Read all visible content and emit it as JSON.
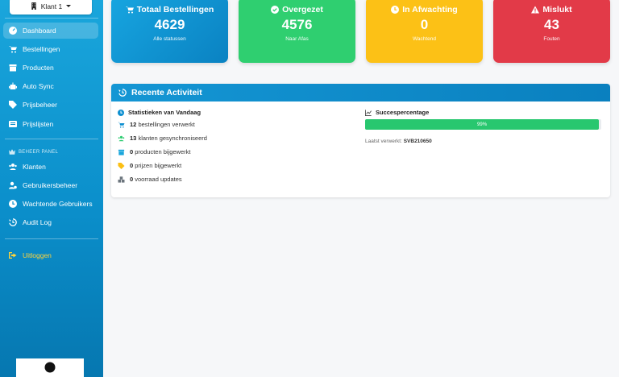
{
  "sidebar": {
    "client_label": "Klant 1",
    "items": [
      {
        "label": "Dashboard",
        "icon": "dashboard-icon"
      },
      {
        "label": "Bestellingen",
        "icon": "cart-icon"
      },
      {
        "label": "Producten",
        "icon": "box-icon"
      },
      {
        "label": "Auto Sync",
        "icon": "robot-icon"
      },
      {
        "label": "Prijsbeheer",
        "icon": "tag-icon"
      },
      {
        "label": "Prijslijsten",
        "icon": "list-icon"
      }
    ],
    "admin_section_label": "BEHEER PANEL",
    "admin_items": [
      {
        "label": "Klanten",
        "icon": "users-icon"
      },
      {
        "label": "Gebruikersbeheer",
        "icon": "user-gear-icon"
      },
      {
        "label": "Wachtende Gebruikers",
        "icon": "clock-icon"
      },
      {
        "label": "Audit Log",
        "icon": "history-icon"
      }
    ],
    "logout_label": "Uitloggen"
  },
  "cards": [
    {
      "title": "Totaal Bestellingen",
      "value": "4629",
      "sub": "Alle statussen",
      "color": "#0d8fd0",
      "icon": "cart-icon"
    },
    {
      "title": "Overgezet",
      "value": "4576",
      "sub": "Naar Afas",
      "color": "#2ecc71",
      "icon": "check-circle-icon"
    },
    {
      "title": "In Afwachting",
      "value": "0",
      "sub": "Wachtend",
      "color": "#fbbf14",
      "icon": "clock-icon"
    },
    {
      "title": "Mislukt",
      "value": "43",
      "sub": "Fouten",
      "color": "#e23a48",
      "icon": "warning-icon"
    }
  ],
  "activity": {
    "title": "Recente Activiteit",
    "stats_title": "Statistieken van Vandaag",
    "stats": [
      {
        "count": "12",
        "text": "bestellingen verwerkt",
        "icon": "cart-icon",
        "color": "#0d8fd0"
      },
      {
        "count": "13",
        "text": "klanten gesynchroniseerd",
        "icon": "users-icon",
        "color": "#2ecc71"
      },
      {
        "count": "0",
        "text": "producten bijgewerkt",
        "icon": "box-icon",
        "color": "#1aa6dc"
      },
      {
        "count": "0",
        "text": "prijzen bijgewerkt",
        "icon": "tag-icon",
        "color": "#fbbf14"
      },
      {
        "count": "0",
        "text": "voorraad updates",
        "icon": "boxes-icon",
        "color": "#6c757d"
      }
    ],
    "success_title": "Succespercentage",
    "success_percent": 99,
    "success_label": "99%",
    "last_processed_label": "Laatst verwerkt:",
    "last_processed_value": "SVB210650"
  }
}
